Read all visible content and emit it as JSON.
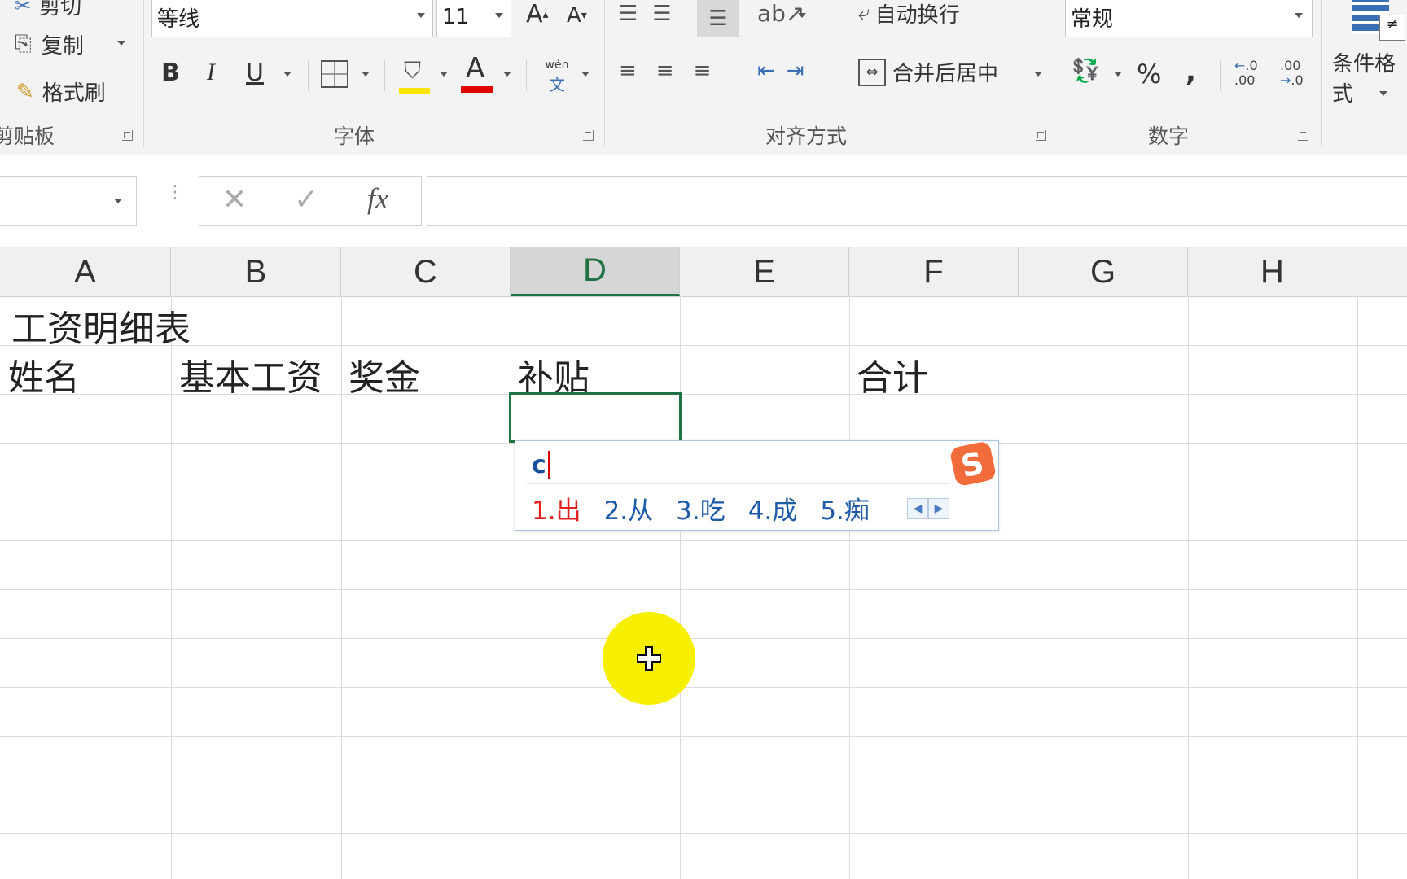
{
  "ribbon": {
    "clipboard": {
      "cut_label": "剪切",
      "copy_label": "复制",
      "format_painter_label": "格式刷",
      "group_label": "剪贴板"
    },
    "font": {
      "font_name": "等线",
      "font_size": "11",
      "grow_label": "A",
      "shrink_label": "A",
      "bold_label": "B",
      "italic_label": "I",
      "underline_label": "U",
      "fill_color": "#FFE600",
      "font_color": "#E00000",
      "font_color_label": "A",
      "phonetic_top": "wén",
      "phonetic_bottom": "文",
      "group_label": "字体"
    },
    "alignment": {
      "wrap_label": "自动换行",
      "merge_label": "合并后居中",
      "group_label": "对齐方式"
    },
    "number": {
      "format_value": "常规",
      "percent_label": "%",
      "comma_label": ",",
      "inc_decimal_label": ".00",
      "dec_decimal_label": ".00",
      "group_label": "数字"
    },
    "styles": {
      "conditional_label": "条件格式"
    }
  },
  "formula_bar": {
    "name_box_value": "",
    "fx_label": "fx",
    "formula_value": ""
  },
  "sheet": {
    "columns": [
      "A",
      "B",
      "C",
      "D",
      "E",
      "F",
      "G",
      "H"
    ],
    "active_column": "D",
    "cells": {
      "A1": "工资明细表",
      "A2": "姓名",
      "B2": "基本工资",
      "C2": "奖金",
      "D2": "补贴",
      "F2": "合计"
    },
    "selected_cell": "D3"
  },
  "ime": {
    "composition": "c",
    "candidates": [
      "1.出",
      "2.从",
      "3.吃",
      "4.成",
      "5.痴"
    ],
    "brand_color": "#F26B3A"
  },
  "colors": {
    "excel_green": "#217346",
    "cursor_highlight": "#F6EF00"
  }
}
